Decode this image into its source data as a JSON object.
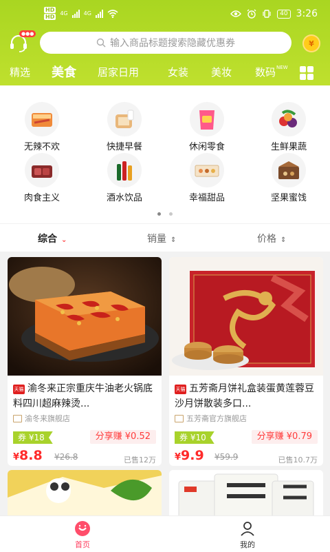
{
  "status_bar": {
    "left_labels": [
      "HD",
      "HD",
      "4G",
      "4G"
    ],
    "battery": "40",
    "time": "3:26"
  },
  "header": {
    "search_placeholder": "输入商品标题搜索隐藏优惠券",
    "service_badge": "●●●",
    "coin_label": "¥"
  },
  "tabs": [
    {
      "label": "精选"
    },
    {
      "label": "美食"
    },
    {
      "label": "居家日用"
    },
    {
      "label": "女装"
    },
    {
      "label": "美妆"
    },
    {
      "label": "数码"
    }
  ],
  "tab_badge": "NEW",
  "categories": [
    {
      "label": "无辣不欢"
    },
    {
      "label": "快捷早餐"
    },
    {
      "label": "休闲零食"
    },
    {
      "label": "生鲜果蔬"
    },
    {
      "label": "肉食主义"
    },
    {
      "label": "酒水饮品"
    },
    {
      "label": "幸福甜品"
    },
    {
      "label": "坚果蜜饯"
    }
  ],
  "sort": {
    "comprehensive": "综合",
    "sales": "销量",
    "price": "价格"
  },
  "products": [
    {
      "mall": "天猫",
      "title": "渝冬来正宗重庆牛油老火锅底料四川超麻辣烫...",
      "shop": "渝冬来旗舰店",
      "coupon": "券 ¥18",
      "share": "分享赚 ¥0.52",
      "price_symbol": "¥",
      "price": "8.8",
      "orig": "¥26.8",
      "sold": "已售12万"
    },
    {
      "mall": "天猫",
      "title": "五芳斋月饼礼盒装蛋黄莲蓉豆沙月饼散装多口...",
      "shop": "五芳斋官方旗舰店",
      "coupon": "券 ¥10",
      "share": "分享赚 ¥0.79",
      "price_symbol": "¥",
      "price": "9.9",
      "orig": "¥59.9",
      "sold": "已售10.7万"
    }
  ],
  "bottom_nav": {
    "home": "首页",
    "mine": "我的"
  },
  "colors": {
    "brand": "#a9d621",
    "price": "#ff2a2a",
    "coupon": "#a8d22b"
  }
}
